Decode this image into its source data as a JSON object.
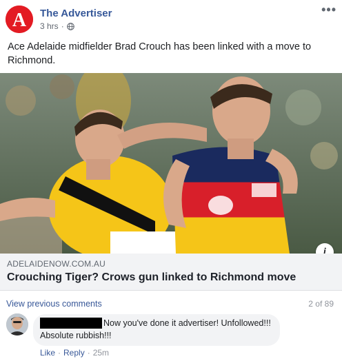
{
  "post": {
    "page_name": "The Advertiser",
    "timestamp": "3 hrs",
    "meta_separator": "·",
    "privacy_icon": "globe-icon",
    "more_icon": "more-options-icon",
    "more_glyph": "•••",
    "text": "Ace Adelaide midfielder Brad Crouch has been linked with a move to Richmond.",
    "avatar_letter": "A",
    "brand_color": "#e31b23"
  },
  "link": {
    "domain": "ADELAIDENOW.COM.AU",
    "title": "Crouching Tiger? Crows gun linked to Richmond move",
    "info_glyph": "i"
  },
  "comments": {
    "view_previous": "View previous comments",
    "count": "2 of 89",
    "items": [
      {
        "text_line1": "Now you've done it advertiser! Unfollowed!!!",
        "text_line2": "Absolute rubbish!!!",
        "like": "Like",
        "reply": "Reply",
        "separator": "·",
        "time": "25m"
      }
    ]
  },
  "colors": {
    "link_blue": "#365899",
    "secondary_text": "#616770",
    "tigers_yellow": "#f5c518",
    "crows_navy": "#1a2a5e",
    "crows_red": "#d81f2a"
  }
}
